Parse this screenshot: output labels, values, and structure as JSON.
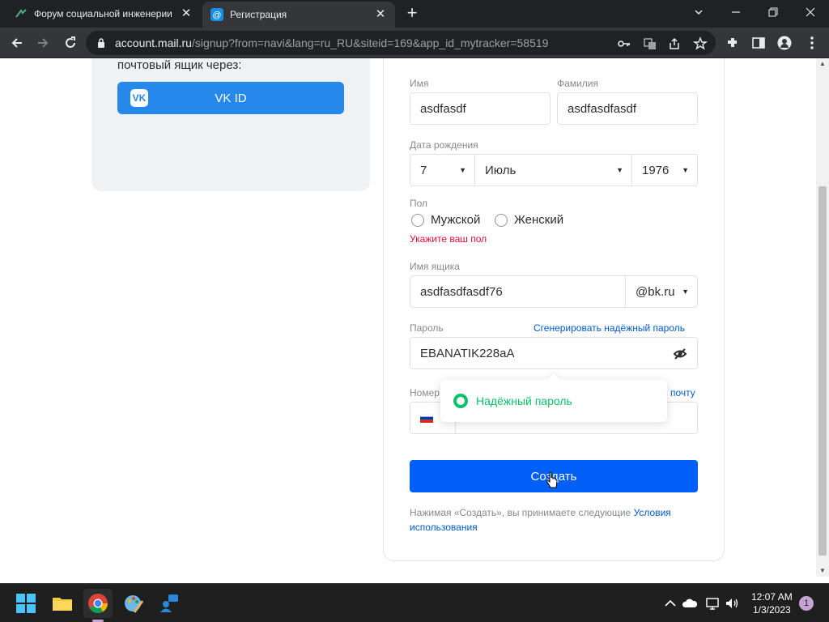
{
  "browser": {
    "tabs": [
      {
        "title": "Форум социальной инженерии",
        "icon": "forum-favicon"
      },
      {
        "title": "Регистрация",
        "icon": "mail-at-favicon"
      }
    ],
    "url_host": "account.mail.ru",
    "url_path": "/signup?from=navi&lang=ru_RU&siteid=169&app_id_mytracker=58519"
  },
  "left": {
    "text": "почтовый ящик через:",
    "vk_label": "VK ID",
    "vk_logo": "VK"
  },
  "form": {
    "first_name_label": "Имя",
    "first_name_value": "asdfasdf",
    "last_name_label": "Фамилия",
    "last_name_value": "asdfasdfasdf",
    "dob_label": "Дата рождения",
    "dob_day": "7",
    "dob_month": "Июль",
    "dob_year": "1976",
    "gender_label": "Пол",
    "gender_male": "Мужской",
    "gender_female": "Женский",
    "gender_error": "Укажите ваш пол",
    "mailbox_label": "Имя ящика",
    "mailbox_value": "asdfasdfasdf76",
    "domain_value": "@bk.ru",
    "password_label": "Пароль",
    "generate_link": "Сгенерировать надёжный пароль",
    "password_value": "EBANATIK228aA",
    "strength_text": "Надёжный пароль",
    "phone_label": "Номер",
    "phone_link": "почту",
    "create_button": "Создать",
    "terms_text": "Нажимая «Создать», вы принимаете следующие ",
    "terms_link_1": "Условия",
    "terms_link_2": "использования"
  },
  "taskbar": {
    "time": "12:07 AM",
    "date": "1/3/2023",
    "notifications": "1"
  },
  "colors": {
    "primary": "#005ff9",
    "vk": "#2688eb",
    "error": "#ed0a34",
    "success": "#0dc268"
  }
}
